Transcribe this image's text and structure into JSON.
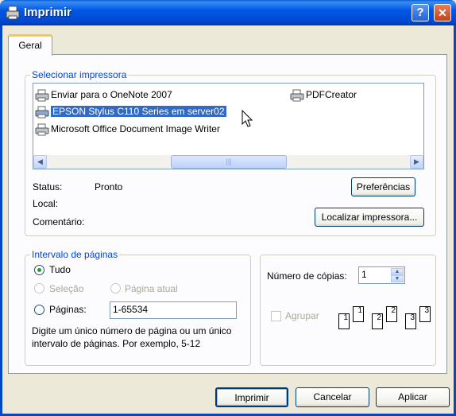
{
  "window": {
    "title": "Imprimir"
  },
  "tabs": [
    {
      "label": "Geral"
    }
  ],
  "select_printer": {
    "legend": "Selecionar impressora",
    "printers": [
      {
        "label": "Enviar para o OneNote 2007",
        "selected": false
      },
      {
        "label": "PDFCreator",
        "selected": false
      },
      {
        "label": "EPSON Stylus C110 Series em server02",
        "selected": true
      },
      {
        "label": "Microsoft Office Document Image Writer",
        "selected": false
      }
    ],
    "status_label": "Status:",
    "status_value": "Pronto",
    "location_label": "Local:",
    "comment_label": "Comentário:",
    "preferences_button": "Preferências",
    "find_printer_button": "Localizar impressora..."
  },
  "page_range": {
    "legend": "Intervalo de páginas",
    "all_label": "Tudo",
    "selection_label": "Seleção",
    "current_page_label": "Página atual",
    "pages_label": "Páginas:",
    "pages_value": "1-65534",
    "hint": "Digite um único número de página ou um único intervalo de páginas. Por exemplo, 5-12"
  },
  "copies": {
    "count_label": "Número de cópias:",
    "count_value": "1",
    "collate_label": "Agrupar",
    "collate_pages": [
      "1",
      "1",
      "2",
      "2",
      "3",
      "3"
    ]
  },
  "footer": {
    "print_button": "Imprimir",
    "cancel_button": "Cancelar",
    "apply_button": "Aplicar"
  },
  "colors": {
    "accent": "#0046D5",
    "selection": "#316AC5",
    "titlebar": "#0058E6"
  }
}
